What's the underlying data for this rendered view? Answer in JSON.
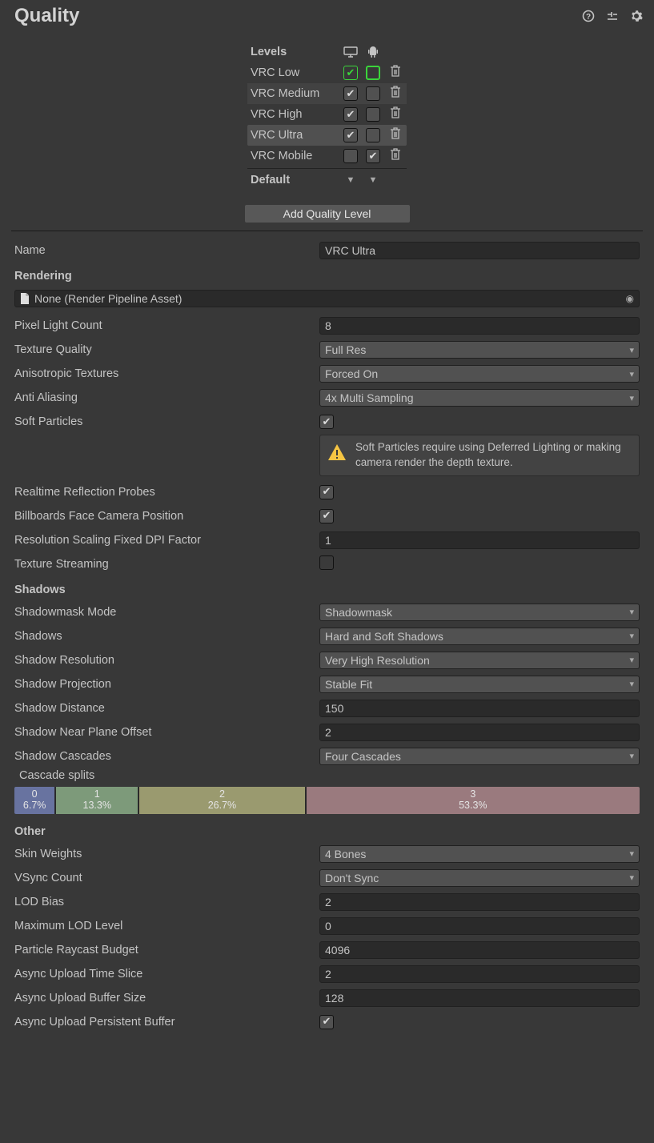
{
  "title": "Quality",
  "levels": {
    "header": "Levels",
    "rows": [
      {
        "name": "VRC Low",
        "c0": "green-on",
        "c1": "green-off",
        "sel": false
      },
      {
        "name": "VRC Medium",
        "c0": "on",
        "c1": "off",
        "sel": false,
        "bg": true
      },
      {
        "name": "VRC High",
        "c0": "on",
        "c1": "off",
        "sel": false
      },
      {
        "name": "VRC Ultra",
        "c0": "on",
        "c1": "off",
        "sel": true
      },
      {
        "name": "VRC Mobile",
        "c0": "off",
        "c1": "on",
        "sel": false
      }
    ],
    "default_label": "Default",
    "add_button": "Add Quality Level"
  },
  "name_label": "Name",
  "name_value": "VRC Ultra",
  "rendering": {
    "header": "Rendering",
    "pipeline": "None (Render Pipeline Asset)",
    "pixel_light_label": "Pixel Light Count",
    "pixel_light_value": "8",
    "tex_quality_label": "Texture Quality",
    "tex_quality_value": "Full Res",
    "aniso_label": "Anisotropic Textures",
    "aniso_value": "Forced On",
    "aa_label": "Anti Aliasing",
    "aa_value": "4x Multi Sampling",
    "soft_label": "Soft Particles",
    "soft_warn": "Soft Particles require using Deferred Lighting or making camera render the depth texture.",
    "refl_label": "Realtime Reflection Probes",
    "bill_label": "Billboards Face Camera Position",
    "dpi_label": "Resolution Scaling Fixed DPI Factor",
    "dpi_value": "1",
    "stream_label": "Texture Streaming"
  },
  "shadows": {
    "header": "Shadows",
    "mask_label": "Shadowmask Mode",
    "mask_value": "Shadowmask",
    "shadows_label": "Shadows",
    "shadows_value": "Hard and Soft Shadows",
    "res_label": "Shadow Resolution",
    "res_value": "Very High Resolution",
    "proj_label": "Shadow Projection",
    "proj_value": "Stable Fit",
    "dist_label": "Shadow Distance",
    "dist_value": "150",
    "near_label": "Shadow Near Plane Offset",
    "near_value": "2",
    "casc_label": "Shadow Cascades",
    "casc_value": "Four Cascades",
    "splits_label": "Cascade splits",
    "splits": [
      {
        "n": "0",
        "p": "6.7%",
        "w": 6.7,
        "c": "#6873a0"
      },
      {
        "n": "1",
        "p": "13.3%",
        "w": 13.3,
        "c": "#7d9a7a"
      },
      {
        "n": "2",
        "p": "26.7%",
        "w": 26.7,
        "c": "#9a9a6f"
      },
      {
        "n": "3",
        "p": "53.3%",
        "w": 53.3,
        "c": "#9a7a7e"
      }
    ]
  },
  "other": {
    "header": "Other",
    "skin_label": "Skin Weights",
    "skin_value": "4 Bones",
    "vsync_label": "VSync Count",
    "vsync_value": "Don't Sync",
    "lod_label": "LOD Bias",
    "lod_value": "2",
    "maxlod_label": "Maximum LOD Level",
    "maxlod_value": "0",
    "ray_label": "Particle Raycast Budget",
    "ray_value": "4096",
    "uts_label": "Async Upload Time Slice",
    "uts_value": "2",
    "ubs_label": "Async Upload Buffer Size",
    "ubs_value": "128",
    "upb_label": "Async Upload Persistent Buffer"
  }
}
